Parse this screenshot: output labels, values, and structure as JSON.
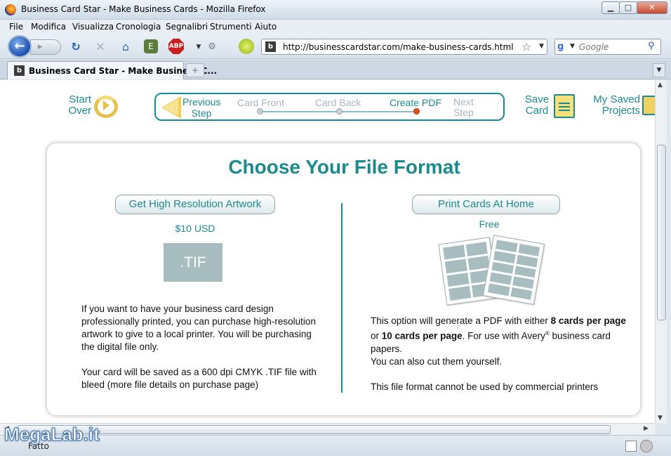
{
  "window": {
    "title": "Business Card Star - Make Business Cards - Mozilla Firefox",
    "minimize": "▁",
    "maximize": "□",
    "close": "✕"
  },
  "menu": [
    "File",
    "Modifica",
    "Visualizza",
    "Cronologia",
    "Segnalibri",
    "Strumenti",
    "Aiuto"
  ],
  "navbar": {
    "url": "http://businesscardstar.com/make-business-cards.html",
    "site_icon": "b",
    "search_placeholder": "Google",
    "abp_label": "ABP"
  },
  "tab": {
    "title": "Business Card Star - Make Business C...",
    "icon": "b",
    "new_tab": "+"
  },
  "steps": {
    "start_over": "Start Over",
    "previous": "Previous Step",
    "labels": [
      "Card Front",
      "Card Back",
      "Create PDF"
    ],
    "next": "Next Step",
    "current": "Create PDF",
    "save_card": "Save Card",
    "my_saved": "My Saved Projects"
  },
  "panel": {
    "title": "Choose Your File Format",
    "hires": {
      "button": "Get High Resolution Artwork",
      "price": "$10 USD",
      "format": ".TIF",
      "para1": "If you want to have your business card design professionally printed, you can purchase high-resolution artwork to give to a local printer. You will be purchasing the digital file only.",
      "para2": "Your card will be saved as a 600 dpi CMYK .TIF file with bleed (more file details on purchase page)"
    },
    "home": {
      "button": "Print Cards At Home",
      "price": "Free",
      "t1": "This option will generate a PDF with either ",
      "b1": "8 cards per page",
      "t2": " or ",
      "b2": "10 cards per page",
      "t3": ".  For use with Avery",
      "reg": "®",
      "t4": " business card papers.",
      "t5": "You can also cut them yourself.",
      "t6": "This file format cannot be used by commercial printers"
    }
  },
  "statusbar": {
    "text": "Fatto"
  },
  "watermark": "MegaLab.it",
  "colors": {
    "teal": "#1b8a8e",
    "card_gray": "#a8bdbf",
    "active_dot": "#e0501e"
  }
}
